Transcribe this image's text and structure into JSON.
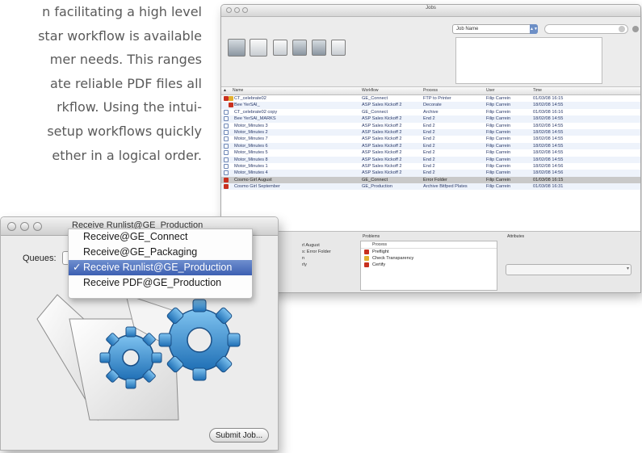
{
  "doc_lines": [
    "n facilitating a high level",
    "star workflow is available",
    "mer needs. This ranges",
    "ate reliable PDF files all",
    "rkflow. Using the intui-",
    "setup workflows quickly",
    "ether in a logical order."
  ],
  "jobs_window": {
    "title": "Jobs",
    "search_field_select": "Job Name",
    "columns": [
      "Name",
      "Workflow",
      "Process",
      "User",
      "Time"
    ],
    "rows": [
      {
        "name": "CT_celebrate02",
        "workflow": "GE_Connect",
        "process": "FTP to Printer",
        "user": "Filip Carrein",
        "time": "01/03/08 16:15",
        "status": "error-warn"
      },
      {
        "name": "Bee YerSAI_",
        "workflow": "ASP Sales Kickoff 2",
        "process": "Decorate",
        "user": "Filip Carrein",
        "time": "18/02/08 14:55",
        "status": "error-inline"
      },
      {
        "name": "CT_celebrate02 copy",
        "workflow": "GE_Connect",
        "process": "Archive",
        "user": "Filip Carrein",
        "time": "01/03/08 16:16",
        "status": "ok"
      },
      {
        "name": "Bee YerSAI_MARKS",
        "workflow": "ASP Sales Kickoff 2",
        "process": "End 2",
        "user": "Filip Carrein",
        "time": "18/02/08 14:55",
        "status": "ok"
      },
      {
        "name": "Motor_Minutes 3",
        "workflow": "ASP Sales Kickoff 2",
        "process": "End 2",
        "user": "Filip Carrein",
        "time": "18/02/08 14:55",
        "status": "ok"
      },
      {
        "name": "Motor_Minutes 2",
        "workflow": "ASP Sales Kickoff 2",
        "process": "End 2",
        "user": "Filip Carrein",
        "time": "18/02/08 14:55",
        "status": "ok"
      },
      {
        "name": "Motor_Minutes 7",
        "workflow": "ASP Sales Kickoff 2",
        "process": "End 2",
        "user": "Filip Carrein",
        "time": "18/02/08 14:55",
        "status": "ok"
      },
      {
        "name": "Motor_Minutes 6",
        "workflow": "ASP Sales Kickoff 2",
        "process": "End 2",
        "user": "Filip Carrein",
        "time": "18/02/08 14:55",
        "status": "ok"
      },
      {
        "name": "Motor_Minutes 5",
        "workflow": "ASP Sales Kickoff 2",
        "process": "End 2",
        "user": "Filip Carrein",
        "time": "18/02/08 14:55",
        "status": "ok"
      },
      {
        "name": "Motor_Minutes 8",
        "workflow": "ASP Sales Kickoff 2",
        "process": "End 2",
        "user": "Filip Carrein",
        "time": "18/02/08 14:55",
        "status": "ok"
      },
      {
        "name": "Motor_Minutes 1",
        "workflow": "ASP Sales Kickoff 2",
        "process": "End 2",
        "user": "Filip Carrein",
        "time": "18/02/08 14:56",
        "status": "ok"
      },
      {
        "name": "Motor_Minutes 4",
        "workflow": "ASP Sales Kickoff 2",
        "process": "End 2",
        "user": "Filip Carrein",
        "time": "18/02/08 14:56",
        "status": "ok"
      },
      {
        "name": "Cosmo Girl August",
        "workflow": "GE_Connect",
        "process": "Error Folder",
        "user": "Filip Carrein",
        "time": "01/03/08 16:15",
        "status": "error",
        "selected": true
      },
      {
        "name": "Cosmo Girl September",
        "workflow": "GE_Production",
        "process": "Archive Bitfped Plates",
        "user": "Filip Carrein",
        "time": "01/03/08 16:31",
        "status": "error"
      }
    ],
    "detail": {
      "problems_header": "Problems",
      "attributes_header": "Attributes",
      "left_lines": [
        "rl August",
        "s: Error Folder",
        "n",
        "rly"
      ],
      "problems_col": "Process",
      "problems": [
        {
          "label": "Preflight",
          "status": "error"
        },
        {
          "label": "Check Transparency",
          "status": "warn"
        },
        {
          "label": "Certify",
          "status": "error"
        }
      ]
    }
  },
  "dialog": {
    "title": "Receive Runlist@GE_Production",
    "queues_label": "Queues:",
    "submit_label": "Submit Job...",
    "menu": [
      {
        "label": "Receive@GE_Connect",
        "selected": false
      },
      {
        "label": "Receive@GE_Packaging",
        "selected": false
      },
      {
        "label": "Receive Runlist@GE_Production",
        "selected": true
      },
      {
        "label": "Receive PDF@GE_Production",
        "selected": false
      }
    ],
    "check_glyph": "✓"
  },
  "colors": {
    "error": "#c8301f",
    "warn": "#e2b030",
    "selection": "#3c5fb2"
  }
}
